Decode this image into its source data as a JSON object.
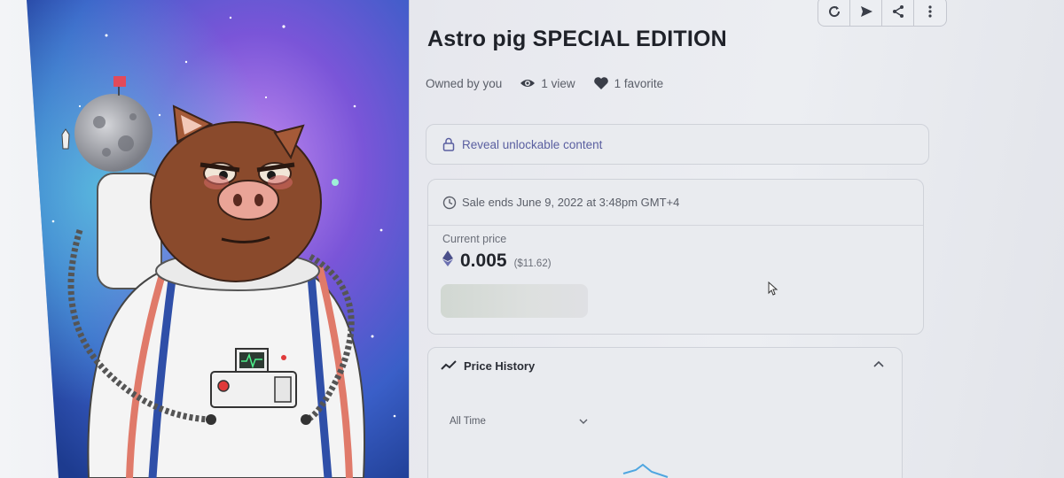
{
  "item": {
    "title": "Astro pig SPECIAL EDITION",
    "owned_by": "Owned by you",
    "views": "1 view",
    "favorites": "1 favorite"
  },
  "toolbar": {
    "icons": [
      "refresh-icon",
      "send-icon",
      "share-icon",
      "more-icon"
    ]
  },
  "unlockable": {
    "label": "Reveal unlockable content"
  },
  "sale": {
    "ends_text": "Sale ends June 9, 2022 at 3:48pm GMT+4",
    "price_label": "Current price",
    "price": "0.005",
    "price_usd": "($11.62)",
    "currency_icon": "ethereum-icon"
  },
  "price_history": {
    "title": "Price History",
    "range": "All Time"
  },
  "colors": {
    "accent": "#5a5fa0",
    "space_blue": "#3b6fd0",
    "space_purple": "#8a4fd6",
    "pig_brown": "#8a4a2c"
  }
}
